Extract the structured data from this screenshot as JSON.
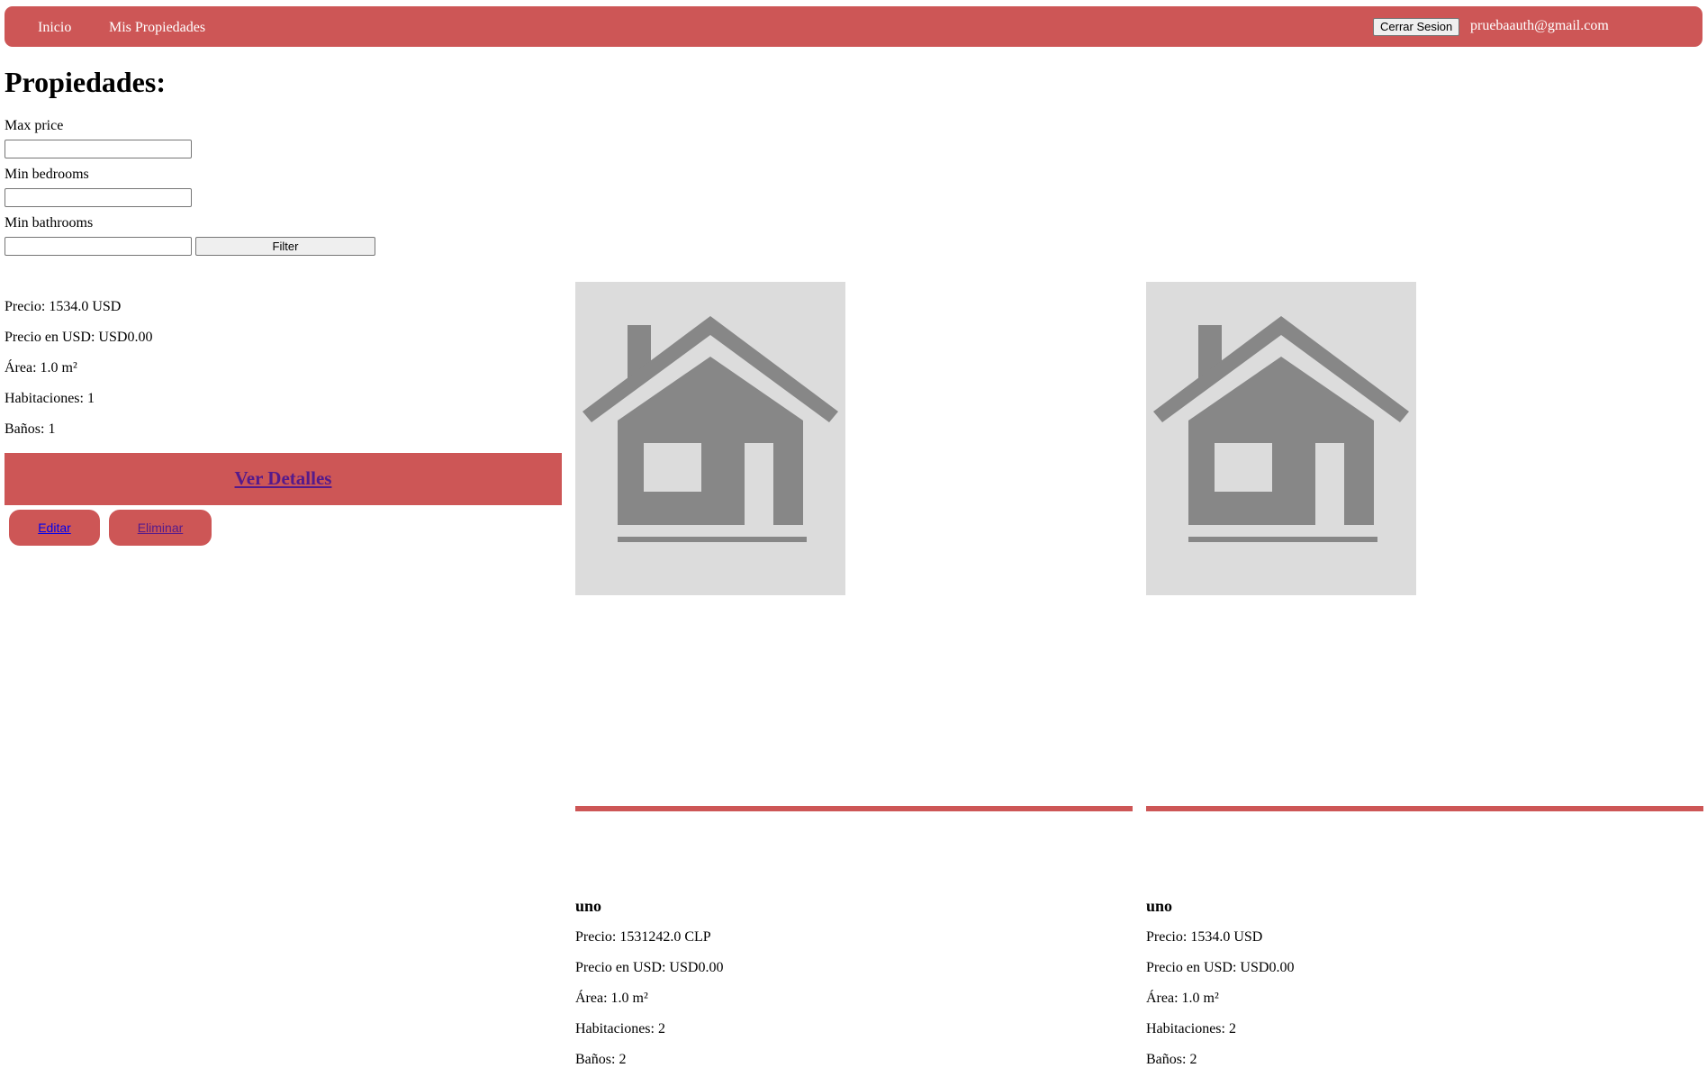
{
  "nav": {
    "home": "Inicio",
    "my_properties": "Mis Propiedades",
    "logout": "Cerrar Sesion",
    "user_email": "pruebaauth@gmail.com"
  },
  "page": {
    "title": "Propiedades:"
  },
  "filters": {
    "max_price_label": "Max price",
    "min_bedrooms_label": "Min bedrooms",
    "min_bathrooms_label": "Min bathrooms",
    "filter_button": "Filter",
    "max_price_value": "",
    "min_bedrooms_value": "",
    "min_bathrooms_value": ""
  },
  "properties": [
    {
      "price": "Precio: 1534.0 USD",
      "price_usd": "Precio en USD: USD0.00",
      "area": "Área: 1.0 m²",
      "rooms": "Habitaciones: 1",
      "baths": "Baños: 1",
      "details": "Ver Detalles",
      "edit": "Editar",
      "delete": "Eliminar"
    },
    {
      "name": "uno",
      "price": "Precio: 1531242.0 CLP",
      "price_usd": "Precio en USD: USD0.00",
      "area": "Área: 1.0 m²",
      "rooms": "Habitaciones: 2",
      "baths": "Baños: 2"
    },
    {
      "name": "uno",
      "price": "Precio: 1534.0 USD",
      "price_usd": "Precio en USD: USD0.00",
      "area": "Área: 1.0 m²",
      "rooms": "Habitaciones: 2",
      "baths": "Baños: 2"
    }
  ],
  "colors": {
    "accent": "#cd5656",
    "placeholder_bg": "#dcdcdc",
    "house_icon": "#878787",
    "visited_link": "#551a8b",
    "link": "#0000ee"
  },
  "icons": {
    "property_image": "house-icon"
  }
}
